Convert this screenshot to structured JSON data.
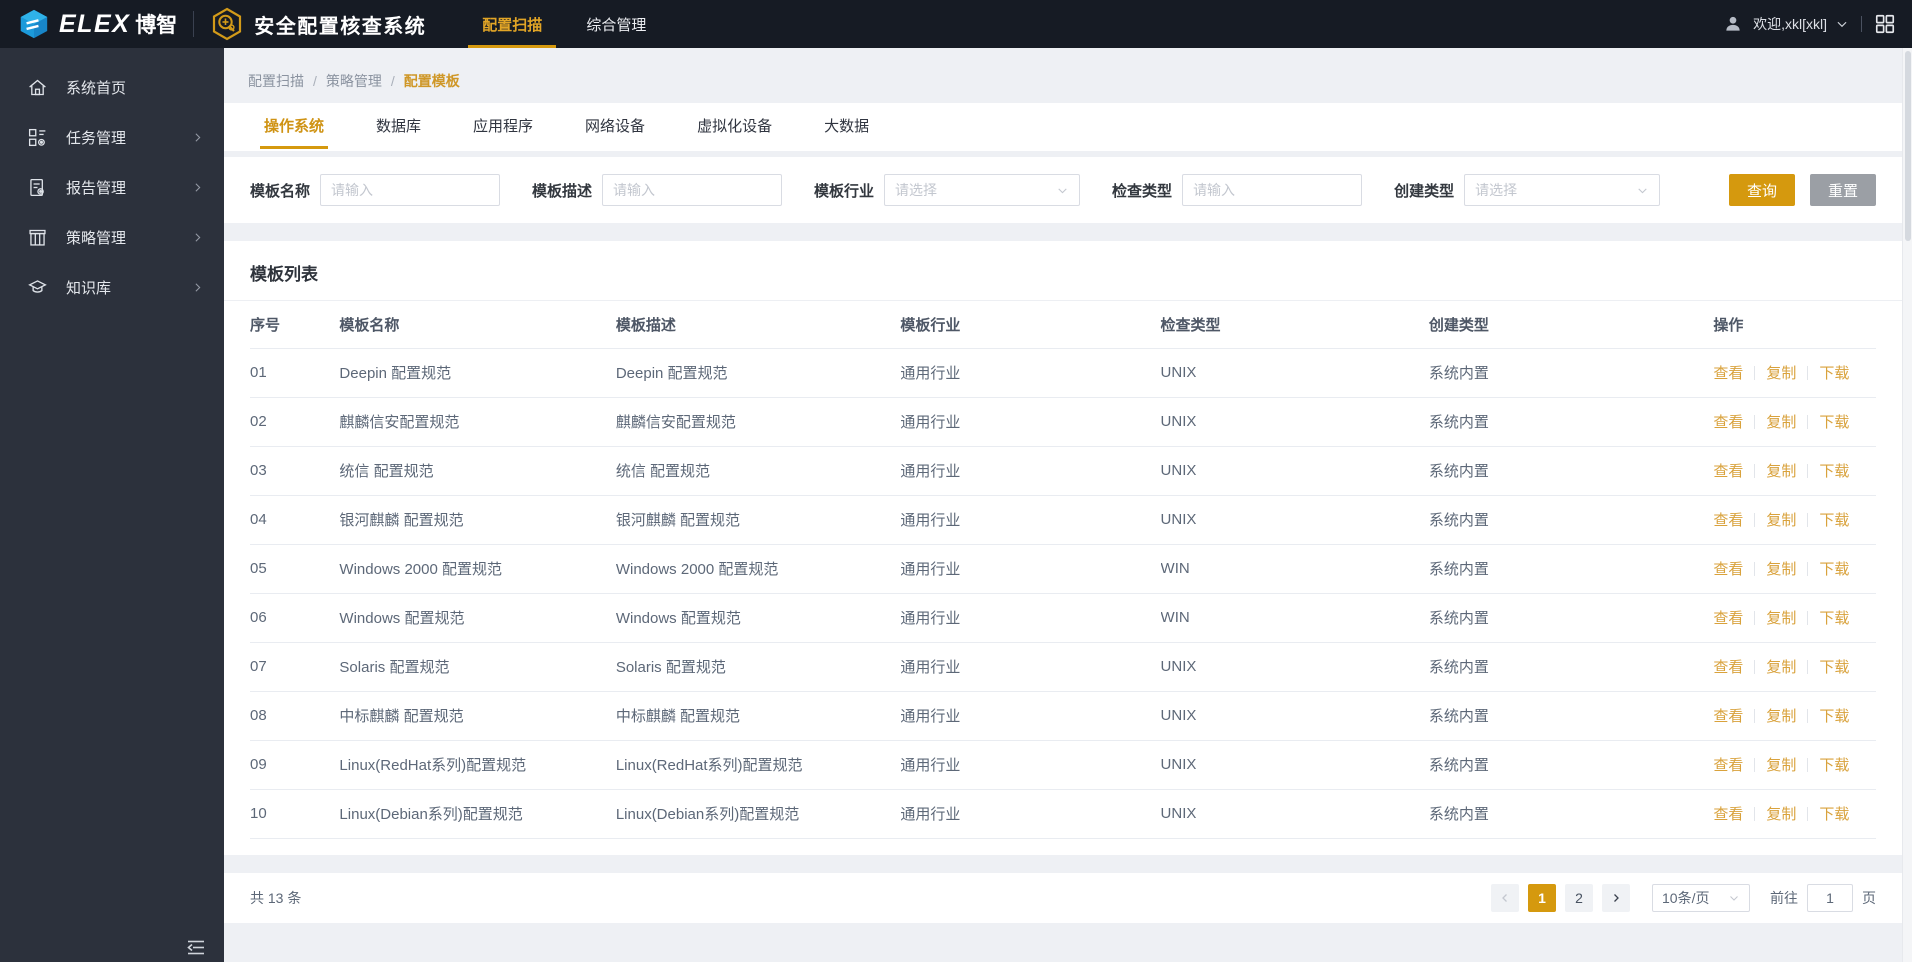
{
  "header": {
    "brand_elex": "ELEX",
    "brand_bozhi": "博智",
    "app_title": "安全配置核查系统",
    "nav": [
      {
        "label": "配置扫描",
        "active": true
      },
      {
        "label": "综合管理",
        "active": false
      }
    ],
    "user_welcome": "欢迎,xkl[xkl]",
    "icons": [
      "elex-logo-icon",
      "app-badge-icon",
      "user-icon",
      "chevron-down-icon",
      "apps-grid-icon"
    ]
  },
  "sidebar": {
    "items": [
      {
        "label": "系统首页",
        "icon": "home-icon",
        "expandable": false
      },
      {
        "label": "任务管理",
        "icon": "tasks-icon",
        "expandable": true
      },
      {
        "label": "报告管理",
        "icon": "report-icon",
        "expandable": true
      },
      {
        "label": "策略管理",
        "icon": "strategy-icon",
        "expandable": true
      },
      {
        "label": "知识库",
        "icon": "knowledge-icon",
        "expandable": true
      }
    ],
    "collapse_icon": "collapse-sidebar-icon"
  },
  "breadcrumb": {
    "separator": "/",
    "items": [
      {
        "label": "配置扫描",
        "current": false
      },
      {
        "label": "策略管理",
        "current": false
      },
      {
        "label": "配置模板",
        "current": true
      }
    ]
  },
  "tabs": [
    {
      "label": "操作系统",
      "active": true
    },
    {
      "label": "数据库",
      "active": false
    },
    {
      "label": "应用程序",
      "active": false
    },
    {
      "label": "网络设备",
      "active": false
    },
    {
      "label": "虚拟化设备",
      "active": false
    },
    {
      "label": "大数据",
      "active": false
    }
  ],
  "filters": {
    "fields": [
      {
        "label": "模板名称",
        "type": "input",
        "placeholder": "请输入"
      },
      {
        "label": "模板描述",
        "type": "input",
        "placeholder": "请输入"
      },
      {
        "label": "模板行业",
        "type": "select",
        "placeholder": "请选择"
      },
      {
        "label": "检查类型",
        "type": "input",
        "placeholder": "请输入"
      },
      {
        "label": "创建类型",
        "type": "select",
        "placeholder": "请选择"
      }
    ],
    "search_label": "查询",
    "reset_label": "重置"
  },
  "table": {
    "title": "模板列表",
    "columns": [
      "序号",
      "模板名称",
      "模板描述",
      "模板行业",
      "检查类型",
      "创建类型",
      "操作"
    ],
    "actions": [
      "查看",
      "复制",
      "下载"
    ],
    "rows": [
      {
        "no": "01",
        "name": "Deepin 配置规范",
        "desc": "Deepin 配置规范",
        "industry": "通用行业",
        "check_type": "UNIX",
        "create_type": "系统内置"
      },
      {
        "no": "02",
        "name": "麒麟信安配置规范",
        "desc": "麒麟信安配置规范",
        "industry": "通用行业",
        "check_type": "UNIX",
        "create_type": "系统内置"
      },
      {
        "no": "03",
        "name": "统信 配置规范",
        "desc": "统信 配置规范",
        "industry": "通用行业",
        "check_type": "UNIX",
        "create_type": "系统内置"
      },
      {
        "no": "04",
        "name": "银河麒麟 配置规范",
        "desc": "银河麒麟 配置规范",
        "industry": "通用行业",
        "check_type": "UNIX",
        "create_type": "系统内置"
      },
      {
        "no": "05",
        "name": "Windows 2000 配置规范",
        "desc": "Windows 2000 配置规范",
        "industry": "通用行业",
        "check_type": "WIN",
        "create_type": "系统内置"
      },
      {
        "no": "06",
        "name": "Windows 配置规范",
        "desc": "Windows 配置规范",
        "industry": "通用行业",
        "check_type": "WIN",
        "create_type": "系统内置"
      },
      {
        "no": "07",
        "name": "Solaris 配置规范",
        "desc": "Solaris 配置规范",
        "industry": "通用行业",
        "check_type": "UNIX",
        "create_type": "系统内置"
      },
      {
        "no": "08",
        "name": "中标麒麟 配置规范",
        "desc": "中标麒麟 配置规范",
        "industry": "通用行业",
        "check_type": "UNIX",
        "create_type": "系统内置"
      },
      {
        "no": "09",
        "name": "Linux(RedHat系列)配置规范",
        "desc": "Linux(RedHat系列)配置规范",
        "industry": "通用行业",
        "check_type": "UNIX",
        "create_type": "系统内置"
      },
      {
        "no": "10",
        "name": "Linux(Debian系列)配置规范",
        "desc": "Linux(Debian系列)配置规范",
        "industry": "通用行业",
        "check_type": "UNIX",
        "create_type": "系统内置"
      }
    ]
  },
  "pagination": {
    "total_text": "共 13 条",
    "pages": [
      {
        "label": "1",
        "active": true
      },
      {
        "label": "2",
        "active": false
      }
    ],
    "prev_icon": "chevron-left-icon",
    "next_icon": "chevron-right-icon",
    "page_size": "10条/页",
    "goto_label": "前往",
    "goto_value": "1",
    "goto_suffix": "页"
  },
  "colors": {
    "accent": "#d5990e",
    "accent_link": "#d9a23c",
    "header_bg": "#161b24",
    "sidebar_bg": "#2c313c",
    "content_bg": "#eef0f4",
    "reset_button_bg": "#9b9fa5"
  }
}
